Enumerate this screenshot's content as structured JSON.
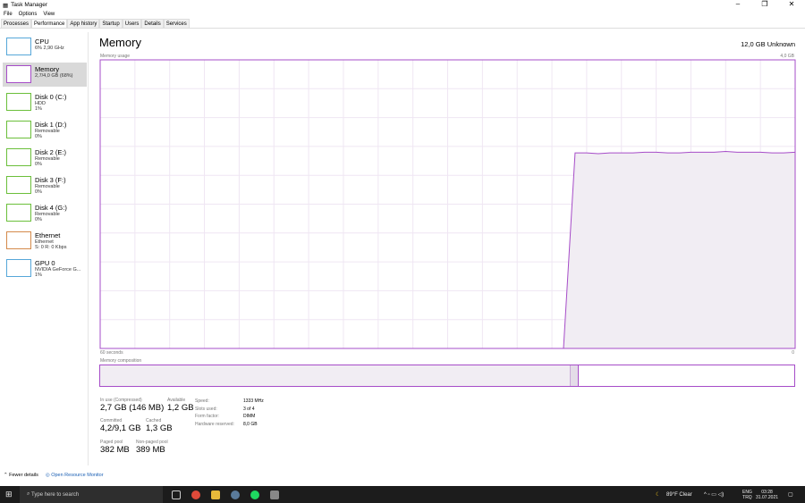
{
  "window": {
    "title": "Task Manager",
    "controls": [
      "–",
      "❐",
      "✕"
    ]
  },
  "menu": [
    "File",
    "Options",
    "View"
  ],
  "tabs": [
    "Processes",
    "Performance",
    "App history",
    "Startup",
    "Users",
    "Details",
    "Services"
  ],
  "active_tab": "Performance",
  "sidebar": [
    {
      "name": "CPU",
      "sub1": "6% 2,90 GHz",
      "sub2": "",
      "color": "#56a7d9"
    },
    {
      "name": "Memory",
      "sub1": "2,7/4,0 GB (68%)",
      "sub2": "",
      "color": "#a64cc8"
    },
    {
      "name": "Disk 0 (C:)",
      "sub1": "HDD",
      "sub2": "1%",
      "color": "#6bbf3a"
    },
    {
      "name": "Disk 1 (D:)",
      "sub1": "Removable",
      "sub2": "0%",
      "color": "#6bbf3a"
    },
    {
      "name": "Disk 2 (E:)",
      "sub1": "Removable",
      "sub2": "0%",
      "color": "#6bbf3a"
    },
    {
      "name": "Disk 3 (F:)",
      "sub1": "Removable",
      "sub2": "0%",
      "color": "#6bbf3a"
    },
    {
      "name": "Disk 4 (G:)",
      "sub1": "Removable",
      "sub2": "0%",
      "color": "#6bbf3a"
    },
    {
      "name": "Ethernet",
      "sub1": "Ethernet",
      "sub2": "S: 0 R: 0 Kbps",
      "color": "#d48a4a"
    },
    {
      "name": "GPU 0",
      "sub1": "NVIDIA GeForce G...",
      "sub2": "1%",
      "color": "#56a7d9"
    }
  ],
  "main": {
    "title": "Memory",
    "total": "12,0 GB Unknown",
    "usage_label": "Memory usage",
    "max_label": "4,0 GB",
    "time_left": "60 seconds",
    "time_right": "0",
    "composition_label": "Memory composition"
  },
  "chart_data": {
    "type": "area",
    "title": "Memory usage",
    "xlabel": "seconds",
    "ylim": [
      0,
      4
    ],
    "xlim": [
      60,
      0
    ],
    "values": [
      0,
      0,
      0,
      0,
      0,
      0,
      0,
      0,
      0,
      0,
      0,
      0,
      0,
      0,
      0,
      0,
      0,
      0,
      0,
      0,
      0,
      0,
      0,
      0,
      0,
      0,
      0,
      0,
      0,
      0,
      0,
      0,
      0,
      0,
      0,
      0,
      0,
      0,
      0,
      0,
      0,
      2.71,
      2.71,
      2.7,
      2.71,
      2.71,
      2.71,
      2.72,
      2.72,
      2.71,
      2.71,
      2.72,
      2.72,
      2.72,
      2.73,
      2.72,
      2.72,
      2.72,
      2.71,
      2.71,
      2.72
    ]
  },
  "composition": {
    "in_use_fraction": 0.678,
    "modified_fraction": 0.011
  },
  "stats": {
    "in_use_label": "In use (Compressed)",
    "in_use": "2,7 GB (146 MB)",
    "available_label": "Available",
    "available": "1,2 GB",
    "committed_label": "Committed",
    "committed": "4,2/9,1 GB",
    "cached_label": "Cached",
    "cached": "1,3 GB",
    "paged_label": "Paged pool",
    "paged": "382 MB",
    "nonpaged_label": "Non-paged pool",
    "nonpaged": "389 MB",
    "details": [
      [
        "Speed:",
        "1333 MHz"
      ],
      [
        "Slots used:",
        "3 of 4"
      ],
      [
        "Form factor:",
        "DIMM"
      ],
      [
        "Hardware reserved:",
        "8,0 GB"
      ]
    ]
  },
  "footer": {
    "fewer": "Fewer details",
    "monitor": "Open Resource Monitor"
  },
  "taskbar": {
    "search": "Type here to search",
    "weather": "89°F  Clear",
    "lang1": "ENG",
    "lang2": "TRQ",
    "time": "03:28",
    "date": "31.07.2021"
  }
}
